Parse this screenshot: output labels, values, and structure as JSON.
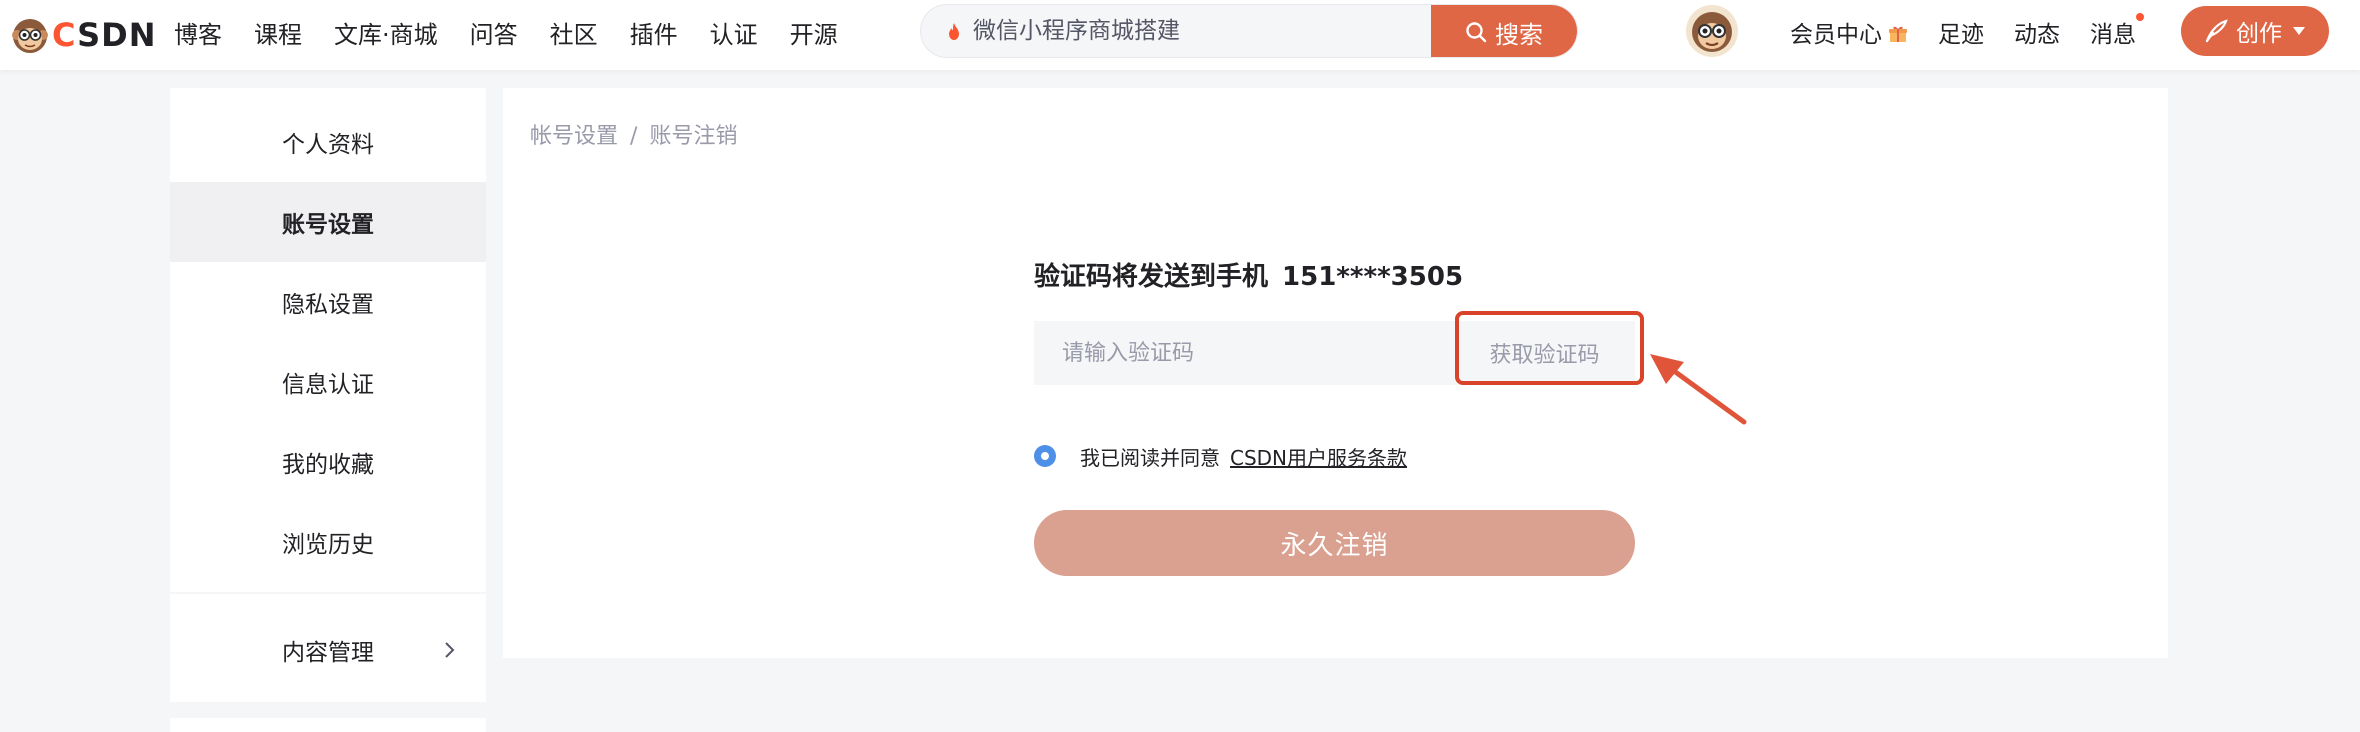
{
  "colors": {
    "brand": "#fc5531",
    "search_button": "#e06745",
    "cancel_button_disabled": "#daa090",
    "highlight": "#d9432a",
    "radio_checked": "#4e8fe8"
  },
  "header": {
    "logo_text": "CSDN",
    "nav": [
      "博客",
      "课程",
      "文库·商城",
      "问答",
      "社区",
      "插件",
      "认证",
      "开源"
    ],
    "search": {
      "placeholder": "微信小程序商城搭建",
      "button_label": "搜索",
      "icon": "fire-icon"
    },
    "right_nav": {
      "vip": "会员中心",
      "footprint": "足迹",
      "activity": "动态",
      "messages": "消息"
    },
    "create_label": "创作"
  },
  "sidebar": {
    "items": [
      {
        "label": "个人资料",
        "active": false
      },
      {
        "label": "账号设置",
        "active": true
      },
      {
        "label": "隐私设置",
        "active": false
      },
      {
        "label": "信息认证",
        "active": false
      },
      {
        "label": "我的收藏",
        "active": false
      },
      {
        "label": "浏览历史",
        "active": false
      }
    ],
    "content_management": "内容管理"
  },
  "main": {
    "breadcrumb": {
      "parent": "帐号设置",
      "separator": "/",
      "current": "账号注销"
    },
    "send_to_label": "验证码将发送到手机",
    "phone": "151****3505",
    "code_input": {
      "value": "",
      "placeholder": "请输入验证码"
    },
    "get_code_label": "获取验证码",
    "agreement": {
      "checked": true,
      "text": "我已阅读并同意",
      "link": "CSDN用户服务条款"
    },
    "cancel_button_label": "永久注销"
  }
}
